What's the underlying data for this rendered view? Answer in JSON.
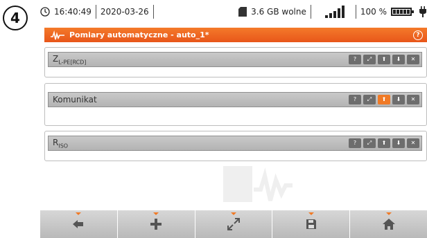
{
  "step_badge": "4",
  "status": {
    "time": "16:40:49",
    "date": "2020-03-26",
    "storage": "3.6 GB wolne",
    "battery_percent": "100 %",
    "signal_bars": 5
  },
  "titlebar": {
    "title": "Pomiary automatyczne - auto_1*",
    "help_label": "?"
  },
  "panels": [
    {
      "main": "Z",
      "sub": "L-PE[RCD]",
      "active_button": ""
    },
    {
      "main": "Komunikat",
      "sub": "",
      "active_button": "up"
    },
    {
      "main": "R",
      "sub": "ISO",
      "active_button": ""
    }
  ],
  "panel_buttons": [
    "help-icon",
    "expand-icon",
    "up-arrow-icon",
    "down-arrow-icon",
    "close-icon"
  ],
  "bottom_nav": [
    "back-arrow-icon",
    "plus-icon",
    "expand-icon",
    "save-icon",
    "home-icon"
  ],
  "colors": {
    "accent": "#f07a26",
    "bar_gray": "#b9b9b9",
    "button_gray": "#6d6d6d"
  }
}
